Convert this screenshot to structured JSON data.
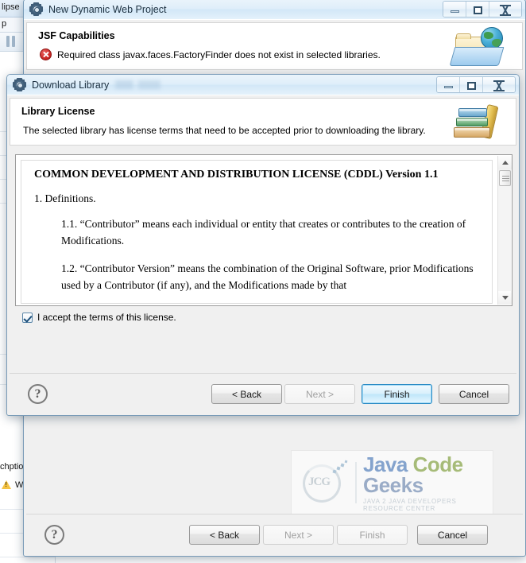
{
  "ide": {
    "title_fragment": "lipse",
    "menu_fragment": "p",
    "pause_icon": "pause-icon",
    "tab_fragment": "chptio",
    "warning_fragment": "Wa",
    "warning_icon": "warning-icon"
  },
  "back_dialog": {
    "title": "New Dynamic Web Project",
    "icon": "gear-icon",
    "header": {
      "title": "JSF Capabilities",
      "message": "Required class javax.faces.FactoryFinder does not exist in selected libraries.",
      "status_icon": "error-icon",
      "banner_icon": "folder-globe-icon"
    },
    "watermark": {
      "word1": "Java",
      "word2": "Code",
      "word3": "Geeks",
      "tagline": "JAVA 2 JAVA DEVELOPERS RESOURCE CENTER",
      "monogram": "JCG",
      "colors": {
        "word1": "#5b86c0",
        "word2": "#8aa84a",
        "word3": "#7a93b8"
      }
    },
    "buttons": {
      "help": "?",
      "back": "< Back",
      "back_mnemonic": "B",
      "next": "Next >",
      "next_mnemonic": "N",
      "finish": "Finish",
      "finish_mnemonic": "F",
      "cancel": "Cancel"
    },
    "window_controls": {
      "minimize": "minimize-icon",
      "maximize": "maximize-icon",
      "close": "close-icon"
    }
  },
  "front_dialog": {
    "title": "Download Library",
    "icon": "gear-icon",
    "header": {
      "title": "Library License",
      "message": "The selected library has license terms that need to be accepted prior to downloading the library.",
      "banner_icon": "books-icon"
    },
    "license": {
      "heading": "COMMON DEVELOPMENT AND DISTRIBUTION LICENSE (CDDL) Version 1.1",
      "section": "1. Definitions.",
      "clause_1_1": "1.1. “Contributor” means each individual or entity that creates or contributes to the creation of Modifications.",
      "clause_1_2": "1.2. “Contributor Version” means the combination of the Original Software, prior Modifications used by a Contributor (if any), and the Modifications made by that"
    },
    "accept": {
      "label": "I accept the terms of this license.",
      "checked": true
    },
    "buttons": {
      "help": "?",
      "back": "< Back",
      "back_mnemonic": "B",
      "next": "Next >",
      "next_mnemonic": "N",
      "finish": "Finish",
      "finish_mnemonic": "F",
      "cancel": "Cancel"
    },
    "window_controls": {
      "minimize": "minimize-icon",
      "maximize": "maximize-icon",
      "close": "close-icon"
    }
  }
}
